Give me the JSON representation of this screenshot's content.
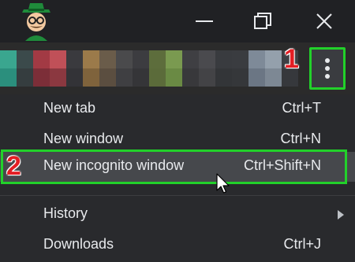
{
  "titlebar": {
    "window_controls": [
      "minimize-icon",
      "restore-icon",
      "close-icon"
    ]
  },
  "annotations": {
    "step1": "1",
    "step2": "2",
    "highlight_color": "#22d12a",
    "number_color": "#e31e24"
  },
  "menu": {
    "items": [
      {
        "label": "New tab",
        "shortcut": "Ctrl+T"
      },
      {
        "label": "New window",
        "shortcut": "Ctrl+N"
      },
      {
        "label": "New incognito window",
        "shortcut": "Ctrl+Shift+N"
      },
      {
        "label": "History",
        "shortcut": ""
      },
      {
        "label": "Downloads",
        "shortcut": "Ctrl+J"
      }
    ],
    "submenu_icon": "chevron-right-icon"
  },
  "toolbar": {
    "menu_icon": "more-vert-icon"
  },
  "colors": {
    "background": "#202124",
    "menu_background": "#292a2d",
    "menu_text": "#e8eaed",
    "highlight_row": "#46484c"
  }
}
